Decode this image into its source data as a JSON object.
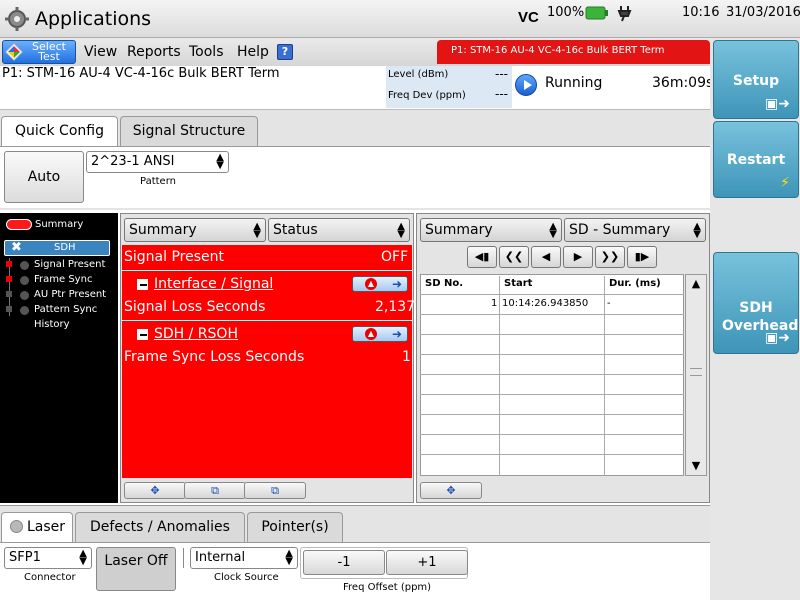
{
  "titlebar": {
    "title": "Applications",
    "logo_text": "VC",
    "battery": "100%",
    "time": "10:16",
    "date": "31/03/2016"
  },
  "menubar": {
    "select_test": "Select Test",
    "items": [
      "View",
      "Reports",
      "Tools",
      "Help"
    ],
    "test_banner": "P1: STM-16 AU-4 VC-4-16c Bulk BERT Term"
  },
  "info": {
    "test_name": "P1: STM-16 AU-4 VC-4-16c Bulk BERT Term",
    "level_label": "Level (dBm)",
    "level_value": "---",
    "freq_label": "Freq Dev (ppm)",
    "freq_value": "---",
    "status": "Running",
    "elapsed": "36m:09s"
  },
  "side_buttons": {
    "setup": "Setup",
    "restart": "Restart",
    "sdh_overhead": "SDH Overhead"
  },
  "config": {
    "tabs": [
      "Quick Config",
      "Signal Structure"
    ],
    "auto": "Auto",
    "pattern_value": "2^23-1 ANSI",
    "pattern_label": "Pattern"
  },
  "tree": {
    "summary": "Summary",
    "sdh": "SDH",
    "items": [
      "Signal Present",
      "Frame Sync",
      "AU Ptr Present",
      "Pattern Sync",
      "History"
    ]
  },
  "status_panel": {
    "view_select": "Summary",
    "category_select": "Status",
    "rows": {
      "signal_present_label": "Signal Present",
      "signal_present_value": "OFF",
      "group1": "Interface / Signal",
      "signal_loss_label": "Signal Loss Seconds",
      "signal_loss_value": "2,137",
      "group2": "SDH / RSOH",
      "frame_sync_loss_label": "Frame Sync Loss Seconds",
      "frame_sync_loss_value": "1"
    }
  },
  "sd_panel": {
    "view_select": "Summary",
    "category_select": "SD - Summary",
    "columns": [
      "SD No.",
      "Start",
      "Dur. (ms)"
    ],
    "rows": [
      {
        "no": "1",
        "start": "10:14:26.943850",
        "dur": "-"
      }
    ]
  },
  "bottom": {
    "tabs": [
      "Laser",
      "Defects / Anomalies",
      "Pointer(s)"
    ],
    "connector_value": "SFP1",
    "connector_label": "Connector",
    "laser_button": "Laser Off",
    "clock_value": "Internal",
    "clock_label": "Clock Source",
    "minus": "-1",
    "plus": "+1",
    "freq_offset_label": "Freq Offset (ppm)"
  },
  "colors": {
    "alarm_red": "#ff0000",
    "side_button_blue": "#4ea3c4",
    "banner_red": "#e31414"
  }
}
